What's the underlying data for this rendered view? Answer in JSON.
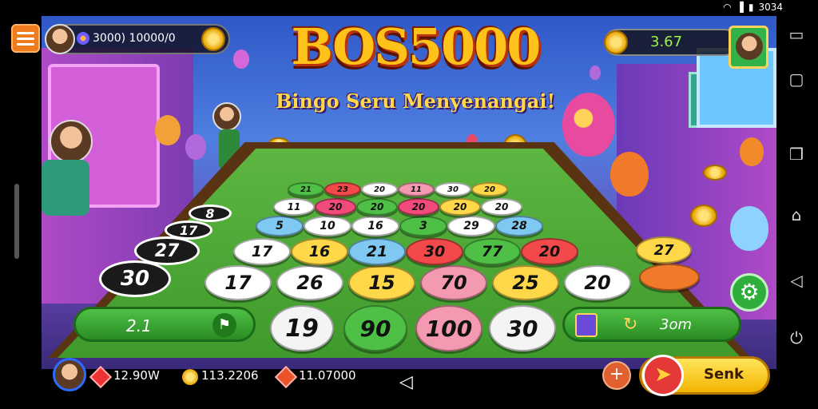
{
  "status": {
    "time": "3034"
  },
  "hud": {
    "top_left_value": "3000) 10000/0",
    "score": "3.67"
  },
  "title": "BOS5000",
  "subtitle": "Bingo Seru Menyenangai!",
  "board": {
    "track_balls": [
      "30",
      "27",
      "8",
      "17"
    ],
    "rows": [
      [
        "17",
        "26",
        "15",
        "70",
        "25",
        "20"
      ],
      [
        "17",
        "16",
        "21",
        "30",
        "77",
        "20"
      ],
      [
        "5",
        "10",
        "16",
        "3",
        "29",
        "28"
      ],
      [
        "11",
        "20",
        "20",
        "20",
        "20",
        "20"
      ],
      [
        "21",
        "23",
        "20",
        "11",
        "30",
        "20"
      ]
    ],
    "bottom_row": [
      "19",
      "90",
      "100",
      "30"
    ],
    "side_ball": "27"
  },
  "pills": {
    "left_value": "2.1",
    "right_value": "3om"
  },
  "bottom_hud": {
    "gems": "12.90W",
    "coins": "113.2206",
    "tickets": "11.07000"
  },
  "buttons": {
    "send_label": "Senk",
    "plus": "+"
  },
  "colors": {
    "accent": "#f2b400",
    "board_green": "#4fb43a",
    "title_gold": "#ffc21b"
  }
}
